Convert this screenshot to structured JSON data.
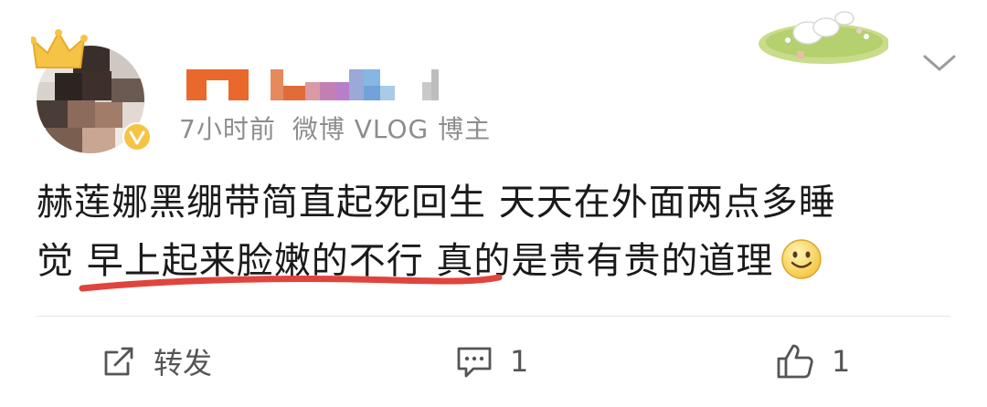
{
  "post": {
    "time": "7小时前",
    "source": "微博 VLOG 博主",
    "body_line1": "赫莲娜黑绷带简直起死回生 天天在外面两点多睡",
    "body_line2": "觉 早上起来脸嫩的不行 真的是贵有贵的道理"
  },
  "actions": {
    "repost_label": "转发",
    "comment_count": "1",
    "like_count": "1"
  },
  "icons": {
    "crown": "crown-icon",
    "vip": "vip-badge-icon",
    "chevron": "chevron-down-icon",
    "smiley": "smiley-emoji-icon",
    "repost": "edit-share-icon",
    "comment": "comment-icon",
    "like": "thumbs-up-icon"
  },
  "colors": {
    "meta_text": "#8d8d8d",
    "body_text": "#1a1a1a",
    "underline": "#e0443d",
    "crown": "#f6c445"
  }
}
